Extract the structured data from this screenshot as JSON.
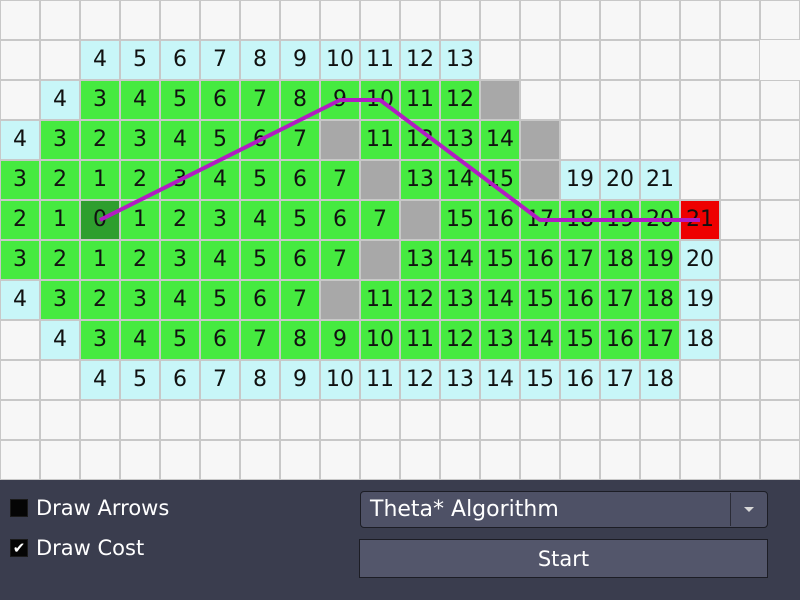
{
  "grid": {
    "rows": [
      "....................",
      "..f4f5f6f7f8f9f10f11f12f13.......",
      ".f4v3v4v5v6v7v8v9v10v11v12w.......",
      "f4v3v2v3v4v5v6v7wv11v12v13v14w......",
      "v3v2v1v2v3v4v5v6v7wv13v14v15wf19f20f21...",
      "v2v1s0v1v2v3v4v5v6v7wv15v16v17v18v19v20g21..",
      "v3v2v1v2v3v4v5v6v7wv13v14v15v16v17v18v19f20..",
      "f4v3v2v3v4v5v6v7wv11v12v13v14v15v16v17v18f19..",
      ".f4v3v4v5v6v7v8v9v10v11v12v13v14v15v16v17f18..",
      "..f4f5f6f7f8f9f10f11f12f13f14f15f16f17f18...",
      "....................",
      "...................."
    ],
    "legend": {
      "empty": "#f7f7f7",
      "frontier": "#c8f6f8",
      "visited": "#46ea40",
      "wall": "#a8a8a8",
      "start": "#2e9e2e",
      "goal": "#ee0000"
    }
  },
  "path": {
    "color": "#b21bc4",
    "cells": [
      [
        5,
        2
      ],
      [
        2,
        8
      ],
      [
        2,
        9
      ],
      [
        5,
        13
      ],
      [
        5,
        17
      ]
    ]
  },
  "panel": {
    "draw_arrows": {
      "label": "Draw Arrows",
      "checked": false
    },
    "draw_cost": {
      "label": "Draw Cost",
      "checked": true,
      "check_glyph": "✔"
    },
    "algorithm_select": {
      "selected": "Theta* Algorithm",
      "arrow_icon": "chevron-down-icon"
    },
    "start_button": {
      "label": "Start"
    }
  }
}
